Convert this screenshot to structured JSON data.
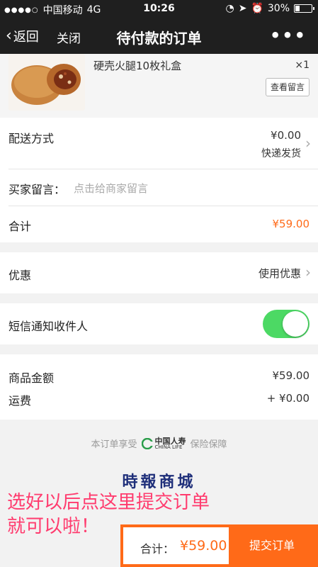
{
  "status": {
    "carrier": "中国移动",
    "network": "4G",
    "time": "10:26",
    "battery": "30%",
    "battery_level": 0.3
  },
  "nav": {
    "back_label": "返回",
    "close_label": "关闭",
    "title": "待付款的订单",
    "more_label": "•••"
  },
  "product": {
    "name": "硬壳火腿10枚礼盒",
    "quantity": "×1",
    "view_memo_label": "查看留言"
  },
  "delivery": {
    "label": "配送方式",
    "price": "¥0.00",
    "method": "快递发货"
  },
  "buyer_message": {
    "label": "买家留言：",
    "placeholder": "点击给商家留言"
  },
  "subtotal": {
    "label": "合计",
    "value": "¥59.00"
  },
  "discount": {
    "label": "优惠",
    "action": "使用优惠"
  },
  "sms_notice": {
    "label": "短信通知收件人",
    "enabled": true
  },
  "summary": {
    "goods_label": "商品金额",
    "goods_value": "¥59.00",
    "shipping_label": "运费",
    "shipping_value": "+ ¥0.00"
  },
  "insurance": {
    "prefix": "本订单享受",
    "logo_cn": "中国人寿",
    "logo_en": "CHINA LIFE",
    "suffix": "保险保障"
  },
  "brand": "時報商城",
  "annotation": {
    "line1": "选好以后点这里提交订单",
    "line2": "就可以啦！"
  },
  "checkout": {
    "total_label": "合计：",
    "total_value": "¥59.00",
    "submit_label": "提交订单"
  },
  "colors": {
    "accent": "#ff6a18",
    "toggle_on": "#4cd964",
    "annotation": "#ff3b6e",
    "brand": "#1f2f7a"
  }
}
